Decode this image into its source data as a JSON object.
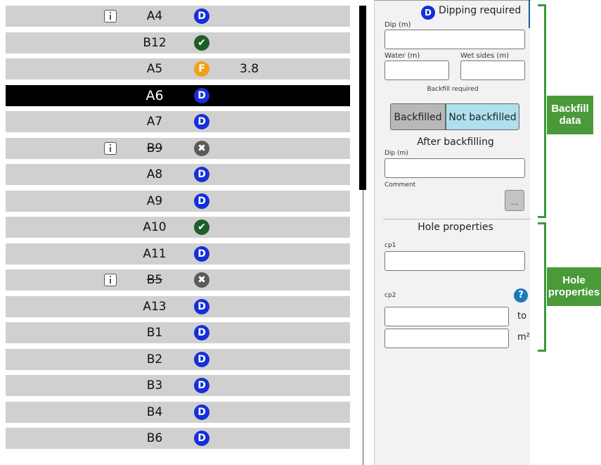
{
  "list": [
    {
      "name": "A4",
      "info": true,
      "status": "D",
      "value": "",
      "struck": false,
      "selected": false
    },
    {
      "name": "B12",
      "info": false,
      "status": "check",
      "value": "",
      "struck": false,
      "selected": false
    },
    {
      "name": "A5",
      "info": false,
      "status": "F",
      "value": "3.8",
      "struck": false,
      "selected": false
    },
    {
      "name": "A6",
      "info": false,
      "status": "D",
      "value": "",
      "struck": false,
      "selected": true
    },
    {
      "name": "A7",
      "info": false,
      "status": "D",
      "value": "",
      "struck": false,
      "selected": false
    },
    {
      "name": "B9",
      "info": true,
      "status": "X",
      "value": "",
      "struck": true,
      "selected": false
    },
    {
      "name": "A8",
      "info": false,
      "status": "D",
      "value": "",
      "struck": false,
      "selected": false
    },
    {
      "name": "A9",
      "info": false,
      "status": "D",
      "value": "",
      "struck": false,
      "selected": false
    },
    {
      "name": "A10",
      "info": false,
      "status": "check",
      "value": "",
      "struck": false,
      "selected": false
    },
    {
      "name": "A11",
      "info": false,
      "status": "D",
      "value": "",
      "struck": false,
      "selected": false
    },
    {
      "name": "B5",
      "info": true,
      "status": "X",
      "value": "",
      "struck": true,
      "selected": false
    },
    {
      "name": "A13",
      "info": false,
      "status": "D",
      "value": "",
      "struck": false,
      "selected": false
    },
    {
      "name": "B1",
      "info": false,
      "status": "D",
      "value": "",
      "struck": false,
      "selected": false
    },
    {
      "name": "B2",
      "info": false,
      "status": "D",
      "value": "",
      "struck": false,
      "selected": false
    },
    {
      "name": "B3",
      "info": false,
      "status": "D",
      "value": "",
      "struck": false,
      "selected": false
    },
    {
      "name": "B4",
      "info": false,
      "status": "D",
      "value": "",
      "struck": false,
      "selected": false
    },
    {
      "name": "B6",
      "info": false,
      "status": "D",
      "value": "",
      "struck": false,
      "selected": false
    }
  ],
  "status_glyphs": {
    "D": "D",
    "check": "✔",
    "F": "F",
    "X": "✖"
  },
  "panel": {
    "dip_status_glyph": "D",
    "dip_title": "Dipping required",
    "dip_label": "Dip (m)",
    "water_label": "Water (m)",
    "wet_sides_label": "Wet sides (m)",
    "backfill_required_label": "Backfill required",
    "backfilled_label": "Backfilled",
    "not_backfilled_label": "Not backfilled",
    "after_backfilling_title": "After backfilling",
    "after_dip_label": "Dip (m)",
    "comment_label": "Comment",
    "comment_button_label": "...",
    "hole_properties_title": "Hole properties",
    "cp1_label": "cp1",
    "cp2_label": "cp2",
    "help_glyph": "?",
    "unit_to": "to",
    "unit_m2": "m²"
  },
  "annotations": {
    "backfill_data": "Backfill data",
    "hole_properties": "Hole properties"
  },
  "colors": {
    "row_bg": "#d0d0d0",
    "selected_row_bg": "#000000",
    "status_D": "#1530d8",
    "status_check": "#1d5e2a",
    "status_F": "#f2a019",
    "status_X": "#5a5a5a",
    "not_backfilled_bg": "#aee0ee",
    "annotation_green": "#4a9a3a"
  }
}
